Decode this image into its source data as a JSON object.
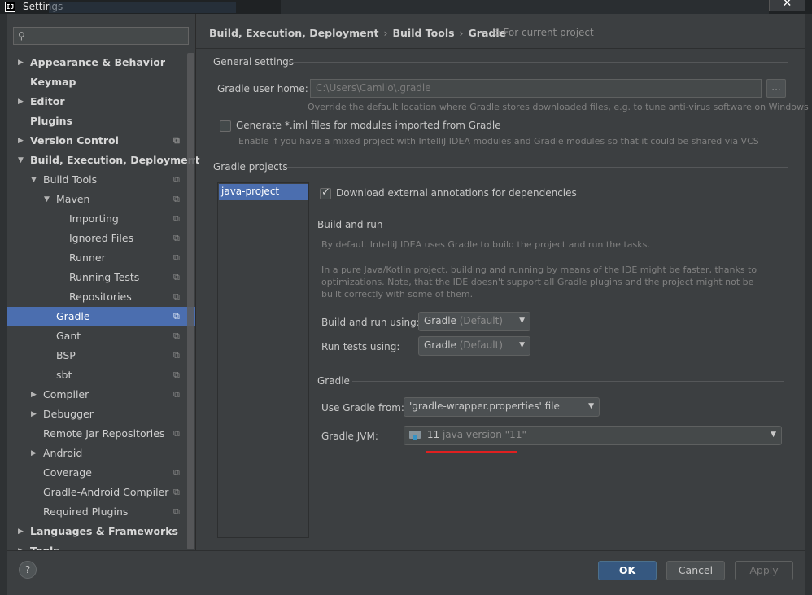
{
  "window": {
    "title": "Settings",
    "close_glyph": "✕",
    "app_icon_text": "IJ"
  },
  "search": {
    "placeholder": "",
    "value": ""
  },
  "tree": [
    {
      "label": "Appearance & Behavior",
      "level": 0,
      "bold": true,
      "arrow": "right",
      "copy": false
    },
    {
      "label": "Keymap",
      "level": 0,
      "bold": true,
      "arrow": "none",
      "copy": false
    },
    {
      "label": "Editor",
      "level": 0,
      "bold": true,
      "arrow": "right",
      "copy": false
    },
    {
      "label": "Plugins",
      "level": 0,
      "bold": true,
      "arrow": "none",
      "copy": false
    },
    {
      "label": "Version Control",
      "level": 0,
      "bold": true,
      "arrow": "right",
      "copy": true
    },
    {
      "label": "Build, Execution, Deployment",
      "level": 0,
      "bold": true,
      "arrow": "down",
      "copy": false
    },
    {
      "label": "Build Tools",
      "level": 1,
      "bold": false,
      "arrow": "down",
      "copy": true
    },
    {
      "label": "Maven",
      "level": 2,
      "bold": false,
      "arrow": "down",
      "copy": true
    },
    {
      "label": "Importing",
      "level": 3,
      "bold": false,
      "arrow": "none",
      "copy": true
    },
    {
      "label": "Ignored Files",
      "level": 3,
      "bold": false,
      "arrow": "none",
      "copy": true
    },
    {
      "label": "Runner",
      "level": 3,
      "bold": false,
      "arrow": "none",
      "copy": true
    },
    {
      "label": "Running Tests",
      "level": 3,
      "bold": false,
      "arrow": "none",
      "copy": true
    },
    {
      "label": "Repositories",
      "level": 3,
      "bold": false,
      "arrow": "none",
      "copy": true
    },
    {
      "label": "Gradle",
      "level": 2,
      "bold": false,
      "arrow": "none",
      "copy": true,
      "selected": true
    },
    {
      "label": "Gant",
      "level": 2,
      "bold": false,
      "arrow": "none",
      "copy": true
    },
    {
      "label": "BSP",
      "level": 2,
      "bold": false,
      "arrow": "none",
      "copy": true
    },
    {
      "label": "sbt",
      "level": 2,
      "bold": false,
      "arrow": "none",
      "copy": true
    },
    {
      "label": "Compiler",
      "level": 1,
      "bold": false,
      "arrow": "right",
      "copy": true
    },
    {
      "label": "Debugger",
      "level": 1,
      "bold": false,
      "arrow": "right",
      "copy": false
    },
    {
      "label": "Remote Jar Repositories",
      "level": 1,
      "bold": false,
      "arrow": "none",
      "copy": true
    },
    {
      "label": "Android",
      "level": 1,
      "bold": false,
      "arrow": "right",
      "copy": false
    },
    {
      "label": "Coverage",
      "level": 1,
      "bold": false,
      "arrow": "none",
      "copy": true
    },
    {
      "label": "Gradle-Android Compiler",
      "level": 1,
      "bold": false,
      "arrow": "none",
      "copy": true
    },
    {
      "label": "Required Plugins",
      "level": 1,
      "bold": false,
      "arrow": "none",
      "copy": true
    },
    {
      "label": "Languages & Frameworks",
      "level": 0,
      "bold": true,
      "arrow": "right",
      "copy": false
    },
    {
      "label": "Tools",
      "level": 0,
      "bold": true,
      "arrow": "right",
      "copy": false,
      "cut": true
    }
  ],
  "breadcrumb": {
    "parts": [
      "Build, Execution, Deployment",
      "Build Tools",
      "Gradle"
    ],
    "separator": "›",
    "scope_note": "For current project"
  },
  "general": {
    "section": "General settings",
    "home_label": "Gradle user home:",
    "home_value": "C:\\Users\\Camilo\\.gradle",
    "browse": "...",
    "home_hint": "Override the default location where Gradle stores downloaded files, e.g. to tune anti-virus software on Windows",
    "iml_label": "Generate *.iml files for modules imported from Gradle",
    "iml_checked": false,
    "iml_hint": "Enable if you have a mixed project with IntelliJ IDEA modules and Gradle modules so that it could be shared via VCS"
  },
  "projects": {
    "section": "Gradle projects",
    "items": [
      "java-project"
    ],
    "annotations_label": "Download external annotations for dependencies",
    "annotations_checked": true,
    "build_run": {
      "section": "Build and run",
      "desc1": "By default IntelliJ IDEA uses Gradle to build the project and run the tasks.",
      "desc2": "In a pure Java/Kotlin project, building and running by means of the IDE might be faster, thanks to optimizations. Note, that the IDE doesn't support all Gradle plugins and the project might not be built correctly with some of them.",
      "build_label": "Build and run using:",
      "build_value": "Gradle",
      "build_suffix": "(Default)",
      "tests_label": "Run tests using:",
      "tests_value": "Gradle",
      "tests_suffix": "(Default)"
    },
    "gradle": {
      "section": "Gradle",
      "use_from_label": "Use Gradle from:",
      "use_from_value": "'gradle-wrapper.properties' file",
      "jvm_label": "Gradle JVM:",
      "jvm_value": "11",
      "jvm_detail": "java version \"11\""
    }
  },
  "footer": {
    "help": "?",
    "ok": "OK",
    "cancel": "Cancel",
    "apply": "Apply"
  },
  "colors": {
    "selection": "#4b6eaf",
    "background": "#3c3f41",
    "ok_button": "#365880",
    "annotation_underline": "#e02020"
  }
}
